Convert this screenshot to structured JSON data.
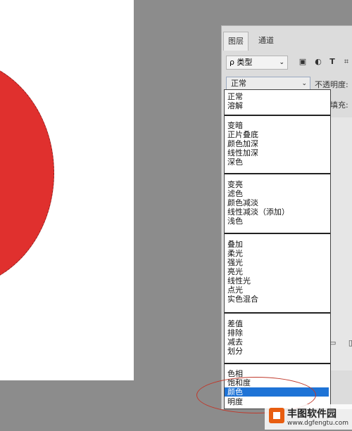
{
  "layers_panel": {
    "tabs": [
      "图层",
      "通道"
    ],
    "filter_label": "ρ 类型",
    "toolbar_icons": [
      "image-filter-icon",
      "adjustment-filter-icon",
      "text-filter-icon",
      "shape-filter-icon"
    ],
    "text_icon_glyph": "T",
    "blend_mode_selected": "正常",
    "opacity_label": "不透明度:",
    "fill_label": "填充:"
  },
  "blend_menu": {
    "groups": [
      [
        "正常",
        "溶解"
      ],
      [
        "变暗",
        "正片叠底",
        "颜色加深",
        "线性加深",
        "深色"
      ],
      [
        "变亮",
        "滤色",
        "颜色减淡",
        "线性减淡（添加）",
        "浅色"
      ],
      [
        "叠加",
        "柔光",
        "强光",
        "亮光",
        "线性光",
        "点光",
        "实色混合"
      ],
      [
        "差值",
        "排除",
        "减去",
        "划分"
      ],
      [
        "色相",
        "饱和度",
        "颜色",
        "明度"
      ]
    ],
    "highlighted": "颜色"
  },
  "watermark": {
    "title": "丰图软件园",
    "url": "www.dgfengtu.com"
  },
  "colors": {
    "canvas_circle": "#e0302e",
    "highlight": "#1e73d6",
    "annotation_ring": "#c0392b"
  }
}
